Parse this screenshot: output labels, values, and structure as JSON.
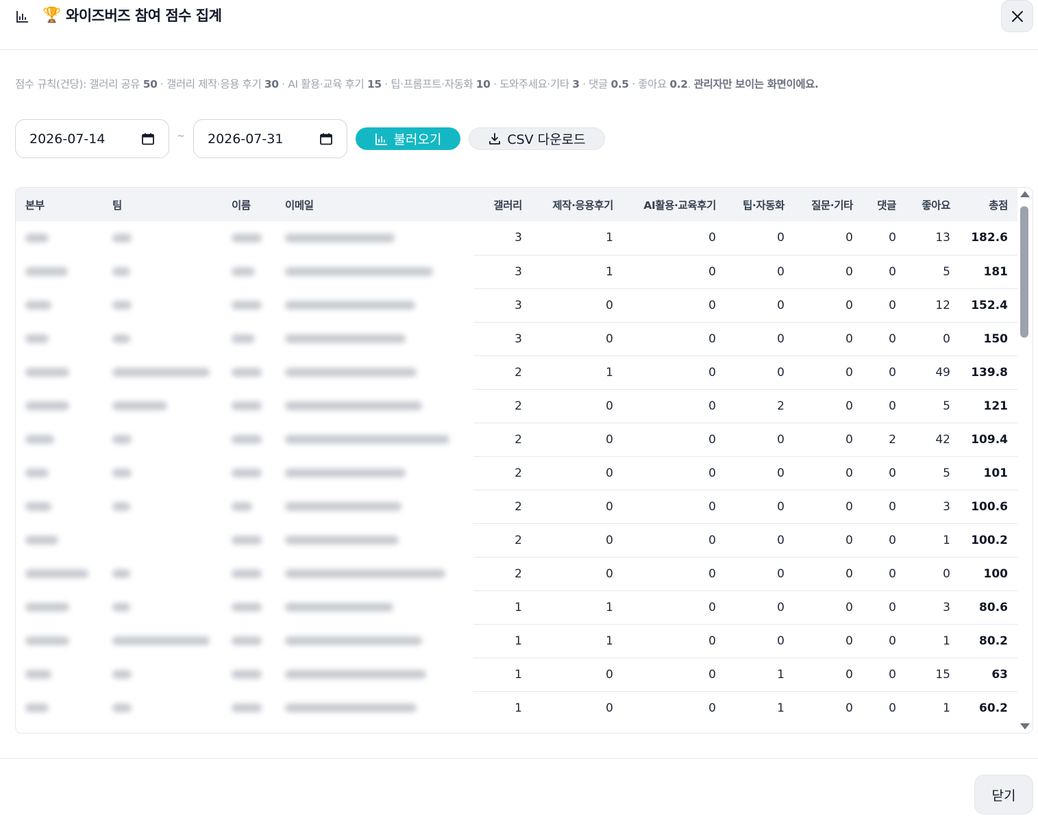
{
  "header": {
    "trophy": "🏆",
    "title": "와이즈버즈 참여 점수 집계",
    "icons": {
      "chart": "bar-chart-icon",
      "close": "close-icon"
    }
  },
  "rules": {
    "prefix": "점수 규칙(건당): ",
    "items": [
      {
        "label": "갤러리 공유 ",
        "value": "50"
      },
      {
        "label": " · 갤러리 제작·응용 후기 ",
        "value": "30"
      },
      {
        "label": " · AI 활용·교육 후기 ",
        "value": "15"
      },
      {
        "label": " · 팁·프롬프트·자동화 ",
        "value": "10"
      },
      {
        "label": " · 도와주세요·기타 ",
        "value": "3"
      },
      {
        "label": " · 댓글 ",
        "value": "0.5"
      },
      {
        "label": " · 좋아요 ",
        "value": "0.2"
      }
    ],
    "suffix_plain": ". ",
    "suffix_bold": "관리자만 보이는 화면이에요."
  },
  "filters": {
    "date_from": "2026-07-14",
    "separator": "~",
    "date_to": "2026-07-31",
    "load_label": "불러오기",
    "csv_label": "CSV 다운로드"
  },
  "table": {
    "columns": [
      "본부",
      "팀",
      "이름",
      "이메일",
      "갤러리",
      "제작·응용후기",
      "AI활용·교육후기",
      "팁·자동화",
      "질문·기타",
      "댓글",
      "좋아요",
      "총점"
    ],
    "rows": [
      [
        "3",
        "1",
        "0",
        "0",
        "0",
        "0",
        "13",
        "182.6"
      ],
      [
        "3",
        "1",
        "0",
        "0",
        "0",
        "0",
        "5",
        "181"
      ],
      [
        "3",
        "0",
        "0",
        "0",
        "0",
        "0",
        "12",
        "152.4"
      ],
      [
        "3",
        "0",
        "0",
        "0",
        "0",
        "0",
        "0",
        "150"
      ],
      [
        "2",
        "1",
        "0",
        "0",
        "0",
        "0",
        "49",
        "139.8"
      ],
      [
        "2",
        "0",
        "0",
        "2",
        "0",
        "0",
        "5",
        "121"
      ],
      [
        "2",
        "0",
        "0",
        "0",
        "0",
        "2",
        "42",
        "109.4"
      ],
      [
        "2",
        "0",
        "0",
        "0",
        "0",
        "0",
        "5",
        "101"
      ],
      [
        "2",
        "0",
        "0",
        "0",
        "0",
        "0",
        "3",
        "100.6"
      ],
      [
        "2",
        "0",
        "0",
        "0",
        "0",
        "0",
        "1",
        "100.2"
      ],
      [
        "2",
        "0",
        "0",
        "0",
        "0",
        "0",
        "0",
        "100"
      ],
      [
        "1",
        "1",
        "0",
        "0",
        "0",
        "0",
        "3",
        "80.6"
      ],
      [
        "1",
        "1",
        "0",
        "0",
        "0",
        "0",
        "1",
        "80.2"
      ],
      [
        "1",
        "0",
        "0",
        "1",
        "0",
        "0",
        "15",
        "63"
      ],
      [
        "1",
        "0",
        "0",
        "1",
        "0",
        "0",
        "1",
        "60.2"
      ]
    ],
    "redacted": true
  },
  "footer": {
    "close_label": "닫기"
  },
  "colors": {
    "accent": "#14b8c4",
    "muted": "#9ca3af",
    "border": "#e5e7eb"
  }
}
